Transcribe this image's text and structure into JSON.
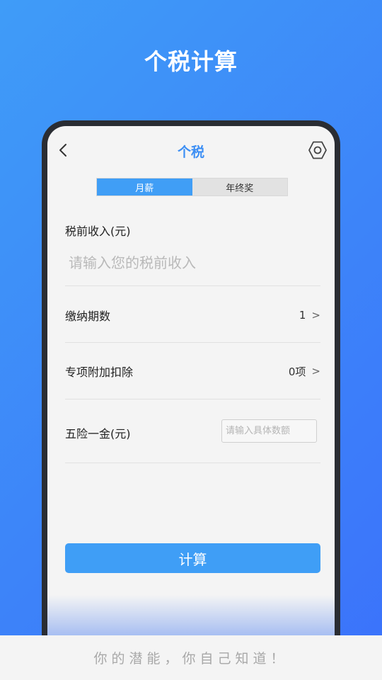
{
  "promo": {
    "title": "个税计算",
    "slogan": "你的潜能，你自己知道！"
  },
  "nav": {
    "title": "个税",
    "back_icon": "chevron-left-icon",
    "settings_icon": "hexagon-gear-icon"
  },
  "tabs": [
    {
      "label": "月薪",
      "active": true
    },
    {
      "label": "年终奖",
      "active": false
    }
  ],
  "form": {
    "income_label": "税前收入(元)",
    "income_placeholder": "请输入您的税前收入",
    "periods": {
      "label": "缴纳期数",
      "value": "1",
      "chevron": ">"
    },
    "deduction": {
      "label": "专项附加扣除",
      "value": "0项",
      "chevron": ">"
    },
    "insurance": {
      "label": "五险一金(元)",
      "placeholder": "请输入具体数额"
    }
  },
  "actions": {
    "calculate_label": "计算"
  },
  "colors": {
    "accent": "#3f9ef6",
    "title_blue": "#3d8ff4",
    "bg_gradient_start": "#3f9cf8",
    "bg_gradient_end": "#3b72fb"
  }
}
